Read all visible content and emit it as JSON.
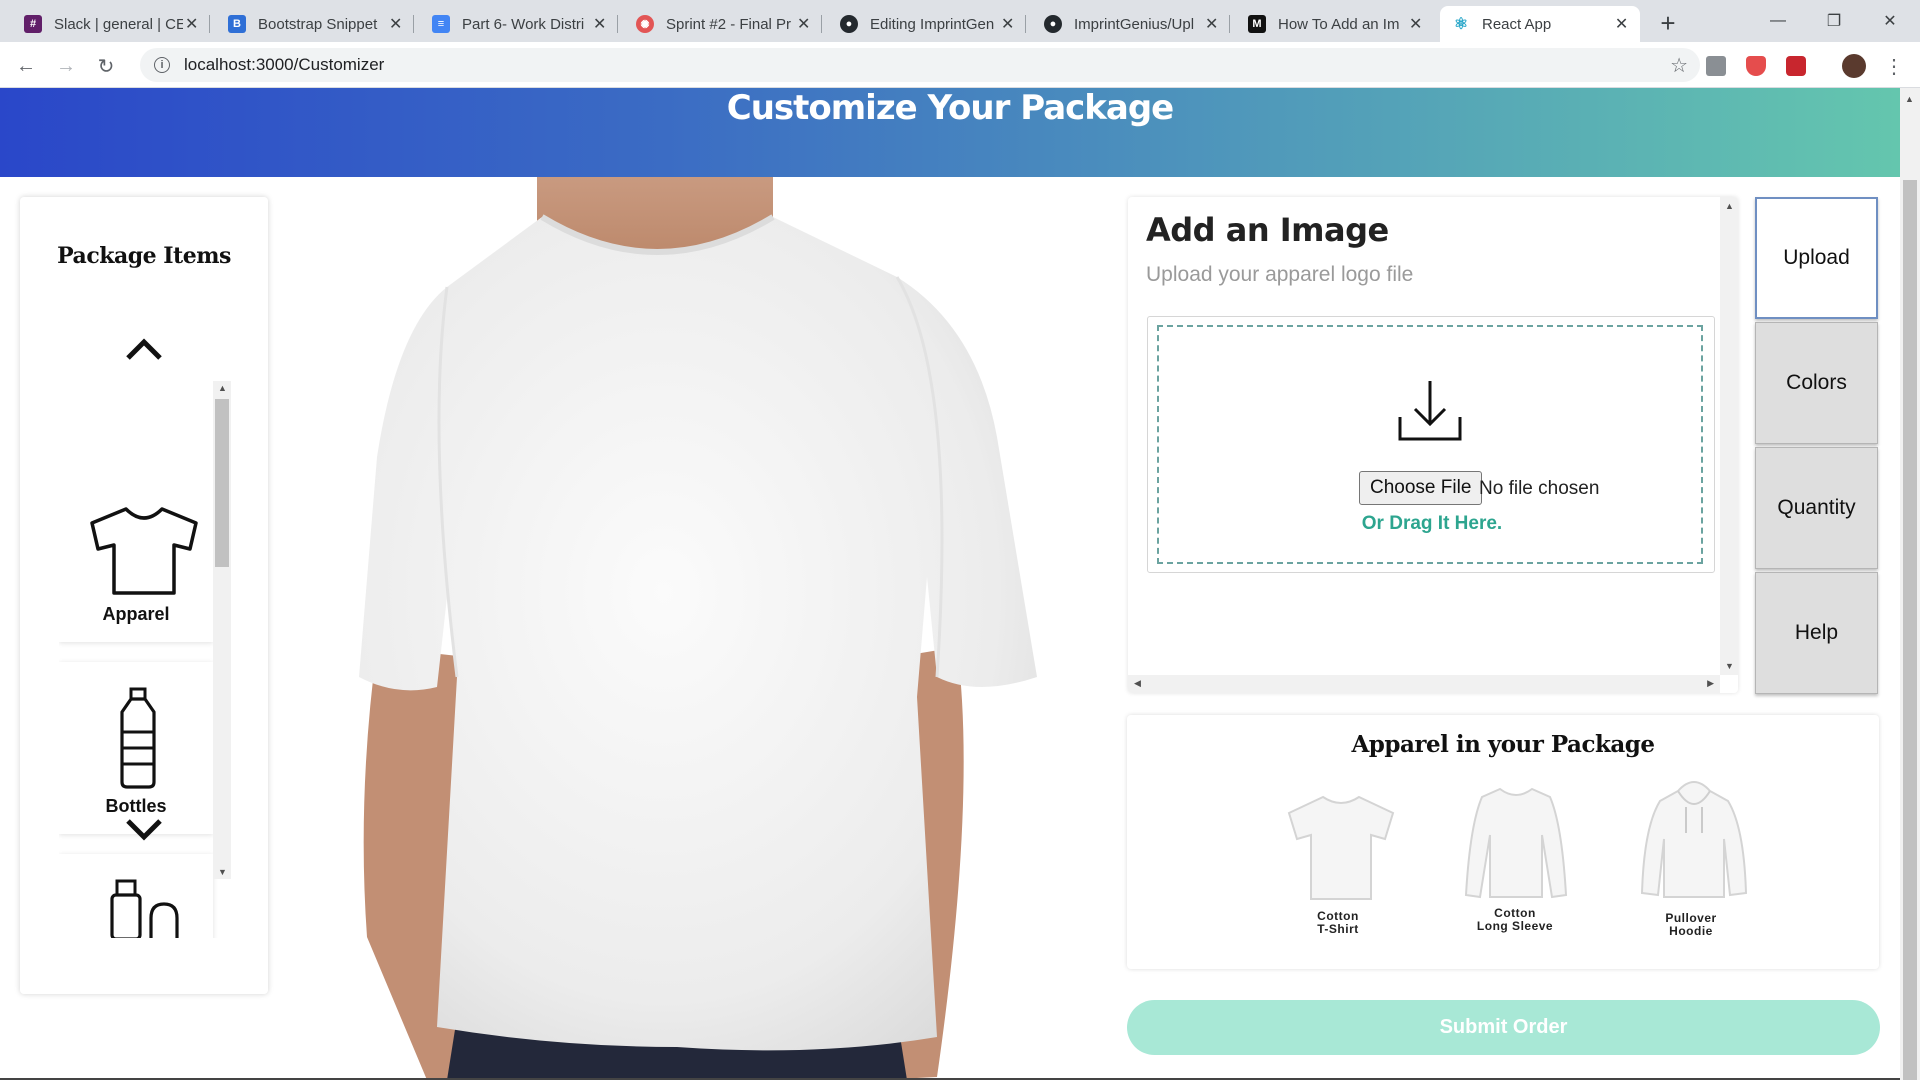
{
  "browser": {
    "tabs": [
      {
        "title": "Slack | general | CE",
        "favicon": "slack-icon",
        "color": "#611f69"
      },
      {
        "title": "Bootstrap Snippet",
        "favicon": "bootstrap-icon",
        "color": "#2f6fd6"
      },
      {
        "title": "Part 6- Work Distri",
        "favicon": "docs-icon",
        "color": "#4285f4"
      },
      {
        "title": "Sprint #2 - Final Pr",
        "favicon": "pinwheel-icon",
        "color": "#e25555"
      },
      {
        "title": "Editing ImprintGen",
        "favicon": "github-icon",
        "color": "#24292e"
      },
      {
        "title": "ImprintGenius/Upl",
        "favicon": "github-icon",
        "color": "#24292e"
      },
      {
        "title": "How To Add an Im",
        "favicon": "medium-icon",
        "color": "#111111"
      },
      {
        "title": "React App",
        "favicon": "react-icon",
        "color": "#2aa7c9"
      }
    ],
    "url": "localhost:3000/Customizer"
  },
  "header": {
    "title": "Customize Your Package"
  },
  "package_items": {
    "title": "Package Items",
    "items": [
      {
        "label": "Apparel",
        "icon": "tshirt-icon"
      },
      {
        "label": "Bottles",
        "icon": "bottle-icon"
      },
      {
        "label": "",
        "icon": "bag-icon"
      }
    ]
  },
  "upload": {
    "title": "Add an Image",
    "subtitle": "Upload your apparel logo file",
    "choose_file": "Choose File",
    "no_file": "No file chosen",
    "drag": "Or Drag It Here."
  },
  "side_tabs": [
    "Upload",
    "Colors",
    "Quantity",
    "Help"
  ],
  "apparel_panel": {
    "title": "Apparel in your Package",
    "items": [
      {
        "line1": "Cotton",
        "line2": "T-Shirt"
      },
      {
        "line1": "Cotton",
        "line2": "Long Sleeve"
      },
      {
        "line1": "Pullover",
        "line2": "Hoodie"
      }
    ]
  },
  "submit_label": "Submit Order",
  "colors": {
    "accent": "#2da58f",
    "submit_bg": "#a8e8d6",
    "header_start": "#2a47c9",
    "header_end": "#64c6ae"
  }
}
